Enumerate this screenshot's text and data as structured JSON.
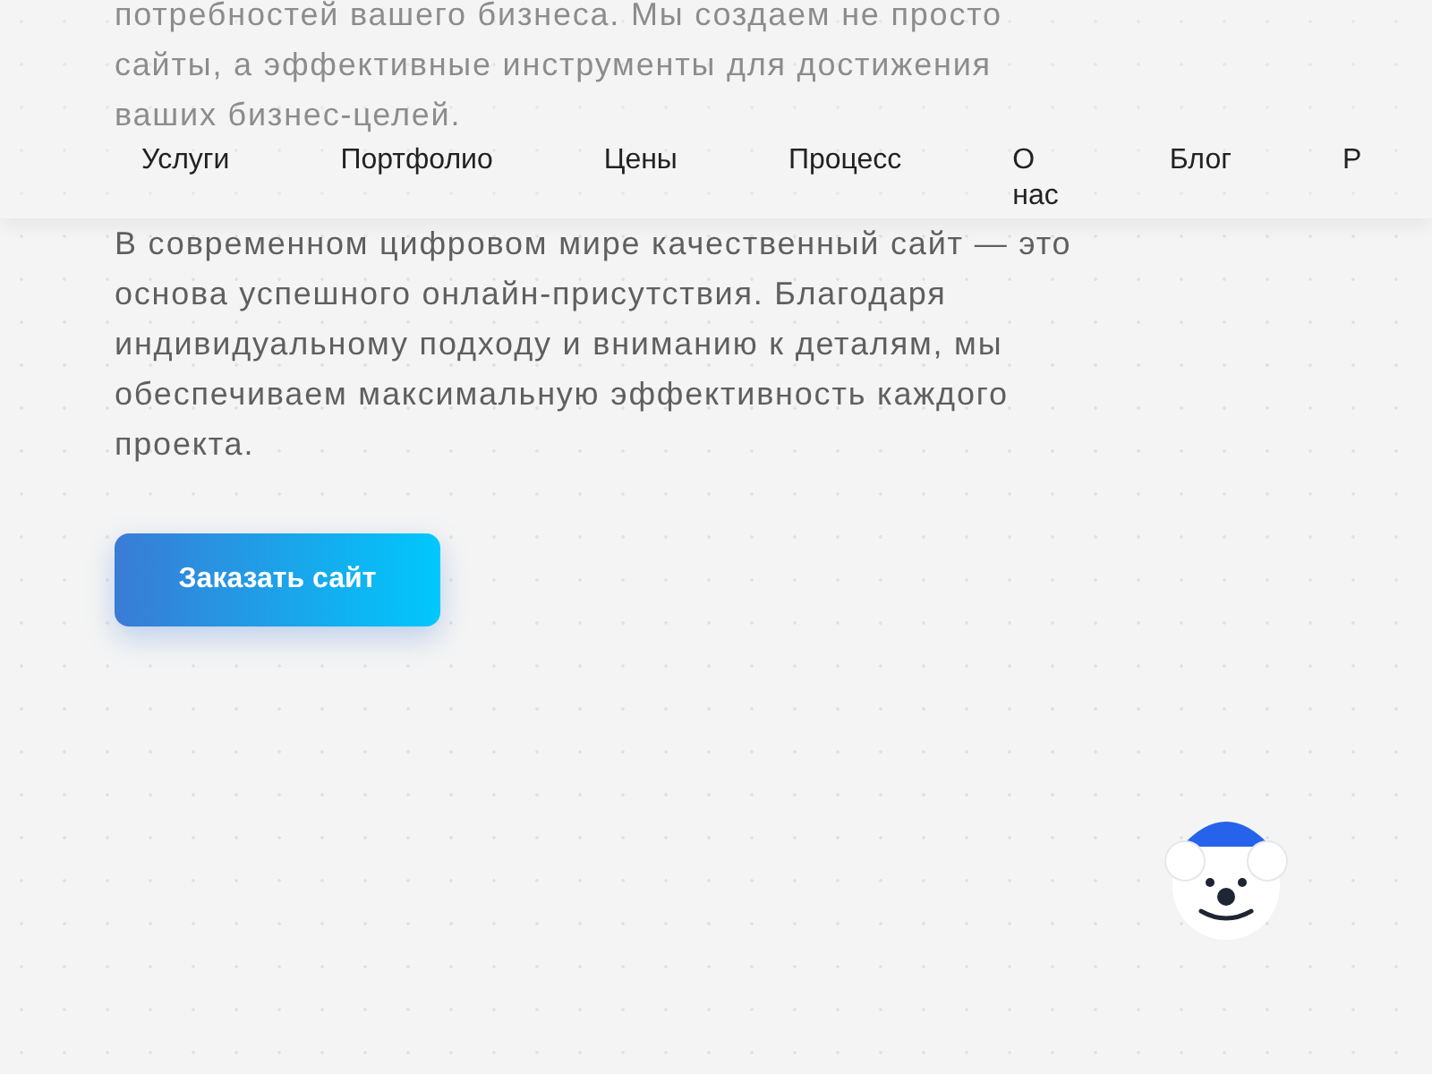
{
  "intro": {
    "paragraphs": [
      "потребностей вашего бизнеса. Мы создаем не просто сайты, а эффективные инструменты для достижения ваших бизнес-целей.",
      "В современном цифровом мире качественный сайт — это основа успешного онлайн-присутствия. Благодаря индивидуальному подходу и вниманию к деталям, мы обеспечиваем максимальную эффективность каждого проекта."
    ]
  },
  "cta_button": "Заказать сайт",
  "nav": {
    "items": [
      "Услуги",
      "Портфолио",
      "Цены",
      "Процесс",
      "О нас",
      "Блог",
      "Р"
    ]
  }
}
